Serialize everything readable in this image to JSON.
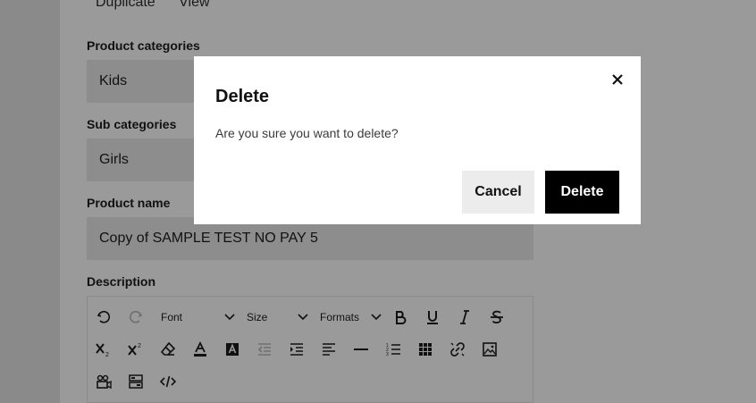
{
  "top_actions": [
    "Duplicate",
    "View"
  ],
  "form": {
    "product_categories": {
      "label": "Product categories",
      "value": "Kids"
    },
    "sub_categories": {
      "label": "Sub categories",
      "value": "Girls"
    },
    "product_name": {
      "label": "Product name",
      "value": "Copy of SAMPLE TEST NO PAY 5"
    },
    "description": {
      "label": "Description"
    }
  },
  "editor": {
    "font_label": "Font",
    "size_label": "Size",
    "formats_label": "Formats",
    "row1_icons": [
      "undo-icon",
      "redo-icon",
      "bold-icon",
      "underline-icon",
      "italic-icon",
      "strikethrough-icon"
    ],
    "row2_icons": [
      "subscript-icon",
      "superscript-icon",
      "eraser-icon",
      "text-color-icon",
      "highlight-color-icon",
      "outdent-icon",
      "indent-icon",
      "align-left-icon",
      "horizontal-rule-icon",
      "numbered-list-icon",
      "table-icon",
      "unlink-icon",
      "image-icon"
    ],
    "row3_icons": [
      "video-icon",
      "template-icon",
      "code-view-icon"
    ]
  },
  "modal": {
    "title": "Delete",
    "message": "Are you sure you want to delete?",
    "cancel_label": "Cancel",
    "delete_label": "Delete"
  },
  "colors": {
    "overlay": "#767676",
    "modal_bg": "#ffffff",
    "delete_button": "#000000",
    "cancel_button": "#ececec"
  }
}
